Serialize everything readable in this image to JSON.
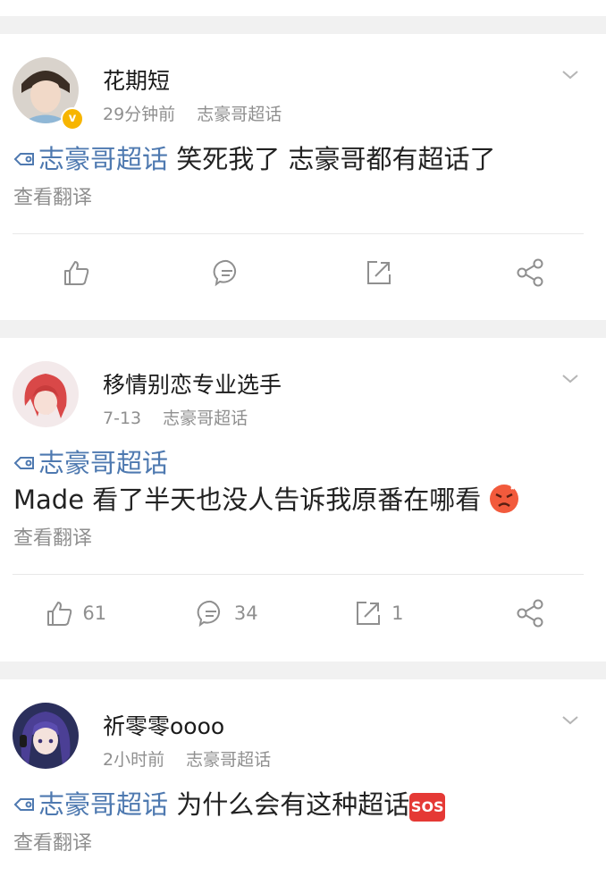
{
  "posts": [
    {
      "username": "花期短",
      "time": "29分钟前",
      "source": "志豪哥超话",
      "topic": "志豪哥超话",
      "text": "笑死我了 志豪哥都有超话了",
      "translate": "查看翻译",
      "verified": true,
      "likes": "",
      "comments": "",
      "reposts": ""
    },
    {
      "username": "移情别恋专业选手",
      "time": "7-13",
      "source": "志豪哥超话",
      "topic": "志豪哥超话",
      "text": "Made 看了半天也没人告诉我原番在哪看",
      "translate": "查看翻译",
      "likes": "61",
      "comments": "34",
      "reposts": "1"
    },
    {
      "username": "祈零零oooo",
      "time": "2小时前",
      "source": "志豪哥超话",
      "topic": "志豪哥超话",
      "text": "为什么会有这种超话",
      "translate": "查看翻译",
      "sos_label": "SOS"
    }
  ],
  "colors": {
    "topic_link": "#4e79b0",
    "meta_gray": "#8f8f8f",
    "separator": "#f1f1f1"
  },
  "icons": [
    "chevron-down-icon",
    "topic-icon",
    "like-icon",
    "comment-icon",
    "repost-icon",
    "share-icon",
    "verified-badge-icon",
    "angry-emoji-icon",
    "sos-emoji-icon"
  ]
}
